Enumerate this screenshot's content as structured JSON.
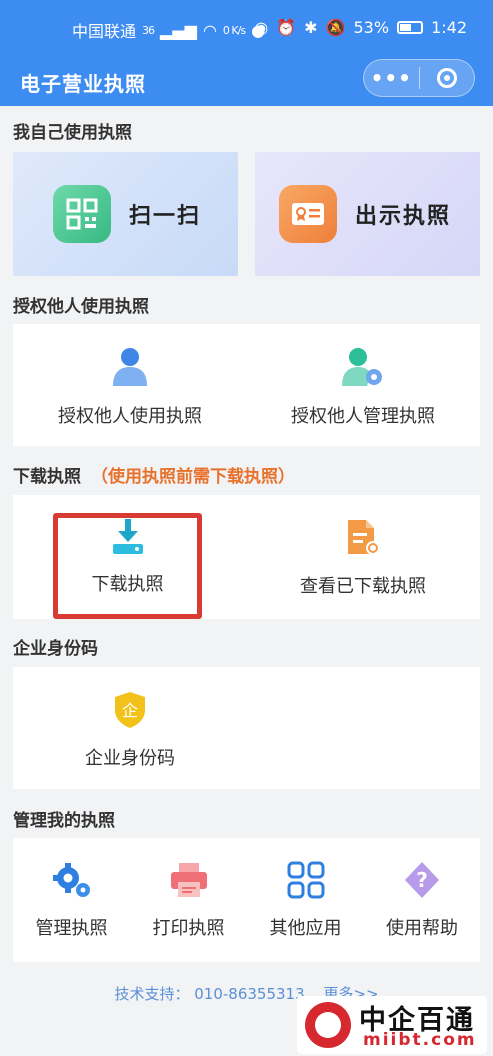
{
  "status_bar": {
    "carrier": "中国联通",
    "net_type": "36",
    "speed": "0 K/s",
    "battery": "53%",
    "time": "1:42"
  },
  "nav": {
    "title": "电子营业执照",
    "more_label": "•••"
  },
  "colors": {
    "primary": "#3d8cf1",
    "accent": "#e8722c",
    "highlight": "#d83b34"
  },
  "sections": {
    "self_use": {
      "title": "我自己使用执照",
      "items": [
        {
          "label": "扫一扫",
          "icon": "qr-scan-icon"
        },
        {
          "label": "出示执照",
          "icon": "license-card-icon"
        }
      ]
    },
    "authorize": {
      "title": "授权他人使用执照",
      "items": [
        {
          "label": "授权他人使用执照",
          "icon": "person-icon"
        },
        {
          "label": "授权他人管理执照",
          "icon": "person-settings-icon"
        }
      ]
    },
    "download": {
      "title": "下载执照",
      "note": "（使用执照前需下载执照）",
      "items": [
        {
          "label": "下载执照",
          "icon": "download-icon"
        },
        {
          "label": "查看已下载执照",
          "icon": "document-icon"
        }
      ]
    },
    "identity": {
      "title": "企业身份码",
      "items": [
        {
          "label": "企业身份码",
          "icon": "enterprise-shield-icon"
        }
      ]
    },
    "manage": {
      "title": "管理我的执照",
      "items": [
        {
          "label": "管理执照",
          "icon": "gear-icon"
        },
        {
          "label": "打印执照",
          "icon": "printer-icon"
        },
        {
          "label": "其他应用",
          "icon": "apps-grid-icon"
        },
        {
          "label": "使用帮助",
          "icon": "help-icon"
        }
      ]
    }
  },
  "footer": {
    "label": "技术支持：",
    "phone": "010-86355313",
    "more": "更多>>"
  },
  "watermark": {
    "name": "中企百通",
    "site": "miibt.com"
  }
}
